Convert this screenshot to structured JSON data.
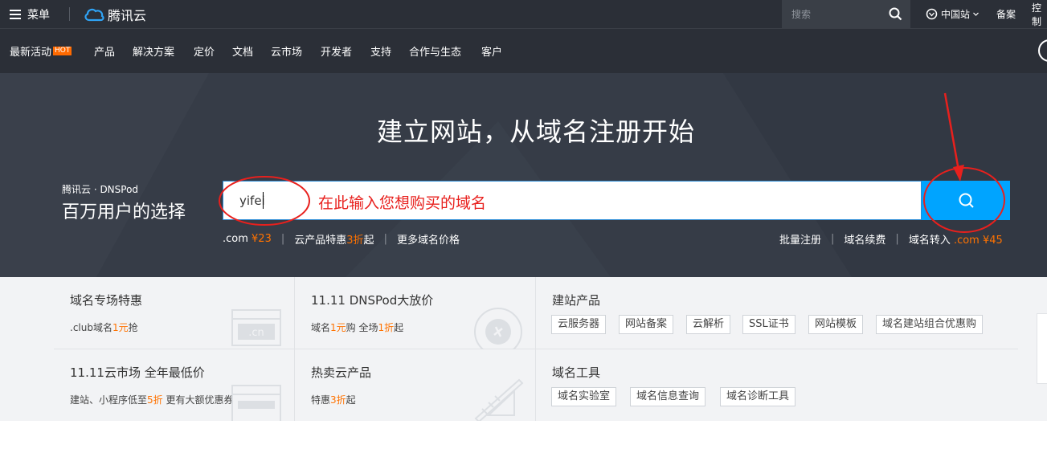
{
  "topbar": {
    "menu_label": "菜单",
    "logo_text": "腾讯云",
    "search_placeholder": "搜索",
    "region_label": "中国站",
    "links": [
      "备案",
      "控制"
    ]
  },
  "nav": {
    "items": [
      "最新活动",
      "产品",
      "解决方案",
      "定价",
      "文档",
      "云市场",
      "开发者",
      "支持",
      "合作与生态",
      "客户"
    ],
    "hot_badge": "HOT"
  },
  "hero": {
    "title": "建立网站，从域名注册开始",
    "brand_small": "腾讯云 · DNSPod",
    "brand_large": "百万用户的选择",
    "input_value": "yifei",
    "input_hint": "在此输入您想购买的域名",
    "left_links": [
      {
        "pre": ".com ",
        "accent": "¥23",
        "post": ""
      },
      {
        "pre": "云产品特惠",
        "accent": "3折",
        "post": "起"
      },
      {
        "pre": "更多域名价格",
        "accent": "",
        "post": ""
      }
    ],
    "right_links": [
      {
        "pre": "批量注册",
        "accent": ""
      },
      {
        "pre": "域名续费",
        "accent": ""
      },
      {
        "pre": "域名转入 ",
        "accent": ".com ¥45"
      }
    ]
  },
  "panels": {
    "cell1": {
      "title": "域名专场特惠",
      "sub_pre": ".club域名",
      "sub_accent": "1元",
      "sub_post": "抢",
      "deco_text": ".cn"
    },
    "cell2": {
      "title": "11.11 DNSPod大放价",
      "sub_pre": "域名",
      "sub_accent": "1元",
      "sub_mid": "购 全场",
      "sub_accent2": "1折",
      "sub_post": "起"
    },
    "cell3": {
      "title": "建站产品",
      "tags": [
        "云服务器",
        "网站备案",
        "云解析",
        "SSL证书",
        "网站模板",
        "域名建站组合优惠购"
      ]
    },
    "cell4": {
      "title": "11.11云市场 全年最低价",
      "sub_pre": "建站、小程序低至",
      "sub_accent": "5折",
      "sub_post": " 更有大额优惠券"
    },
    "cell5": {
      "title": "热卖云产品",
      "sub_pre": "特惠",
      "sub_accent": "3折",
      "sub_post": "起"
    },
    "cell6": {
      "title": "域名工具",
      "tags": [
        "域名实验室",
        "域名信息查询",
        "域名诊断工具"
      ]
    }
  },
  "colors": {
    "accent": "#ff7200",
    "primary": "#00a4ff",
    "annotation": "#e8201d",
    "dark": "#2b2f37"
  }
}
